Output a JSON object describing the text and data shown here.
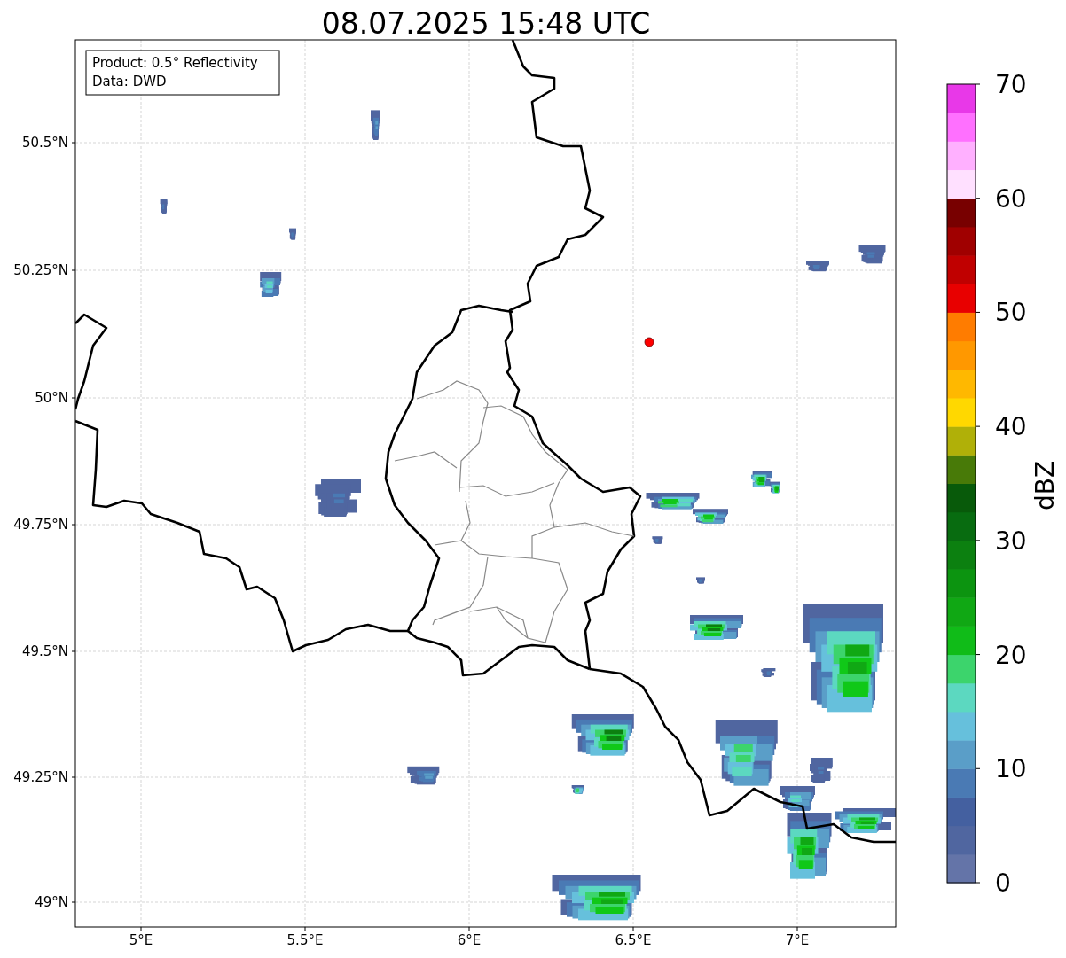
{
  "title": "08.07.2025 15:48 UTC",
  "legend": [
    "Product: 0.5° Reflectivity",
    "Data: DWD"
  ],
  "map": {
    "x_ticks": [
      "5°E",
      "5.5°E",
      "6°E",
      "6.5°E",
      "7°E"
    ],
    "y_ticks": [
      "50.5°N",
      "50.25°N",
      "50°N",
      "49.75°N",
      "49.5°N",
      "49.25°N",
      "49°N"
    ]
  },
  "colorbar": {
    "label": "dBZ",
    "ticks": [
      "70",
      "60",
      "50",
      "40",
      "30",
      "20",
      "10",
      "0"
    ],
    "segments": [
      {
        "color": "#6474a8"
      },
      {
        "color": "#5066a0"
      },
      {
        "color": "#4460a0"
      },
      {
        "color": "#4a7ab4"
      },
      {
        "color": "#5a9ec8"
      },
      {
        "color": "#66c0dc"
      },
      {
        "color": "#5cd8c0"
      },
      {
        "color": "#3cd46c"
      },
      {
        "color": "#10bc18"
      },
      {
        "color": "#10a814"
      },
      {
        "color": "#0c9410"
      },
      {
        "color": "#0c8010"
      },
      {
        "color": "#086c10"
      },
      {
        "color": "#085a0a"
      },
      {
        "color": "#487a08"
      },
      {
        "color": "#b0b008"
      },
      {
        "color": "#ffd800"
      },
      {
        "color": "#ffb800"
      },
      {
        "color": "#ff9800"
      },
      {
        "color": "#ff7c00"
      },
      {
        "color": "#e80000"
      },
      {
        "color": "#c00000"
      },
      {
        "color": "#a00000"
      },
      {
        "color": "#780000"
      },
      {
        "color": "#ffe0ff"
      },
      {
        "color": "#ffb0ff"
      },
      {
        "color": "#ff70ff"
      },
      {
        "color": "#e838e8"
      }
    ]
  }
}
